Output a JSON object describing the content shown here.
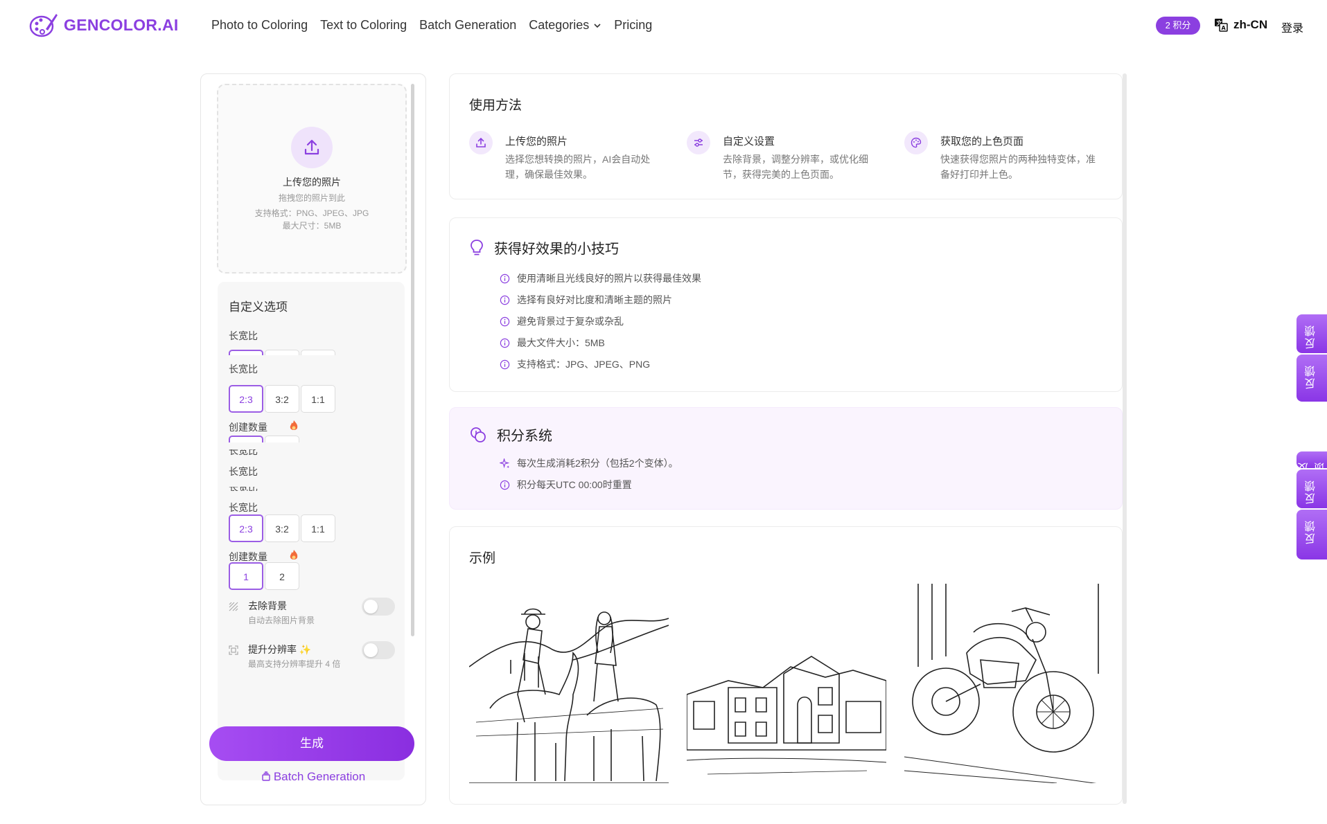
{
  "header": {
    "logo_text": "GENCOLOR.AI",
    "nav": [
      "Photo to Coloring",
      "Text to Coloring",
      "Batch Generation",
      "Categories",
      "Pricing"
    ],
    "credits_badge": "2 积分",
    "language": "zh-CN",
    "login": "登录"
  },
  "upload": {
    "title": "上传您的照片",
    "drag_hint": "拖拽您的照片到此",
    "formats": "支持格式：PNG、JPEG、JPG",
    "max_size": "最大尺寸：5MB"
  },
  "options": {
    "title": "自定义选项",
    "aspect_label": "长宽比",
    "aspect_options": [
      "2:3",
      "3:2",
      "1:1"
    ],
    "aspect_selected": "2:3",
    "count_label": "创建数量",
    "count_options": [
      "1",
      "2"
    ],
    "count_selected": "1",
    "remove_bg_label": "去除背景",
    "remove_bg_sub": "自动去除图片背景",
    "remove_bg_on": false,
    "upscale_label": "提升分辨率 ✨",
    "upscale_sub": "最高支持分辨率提升 4 倍",
    "upscale_on": false
  },
  "actions": {
    "generate": "生成",
    "batch": "Batch Generation"
  },
  "how_to": {
    "title": "使用方法",
    "steps": [
      {
        "icon": "upload-icon",
        "title": "上传您的照片",
        "desc": "选择您想转换的照片，AI会自动处理，确保最佳效果。"
      },
      {
        "icon": "sliders-icon",
        "title": "自定义设置",
        "desc": "去除背景，调整分辨率，或优化细节，获得完美的上色页面。"
      },
      {
        "icon": "palette-icon",
        "title": "获取您的上色页面",
        "desc": "快速获得您照片的两种独特变体，准备好打印并上色。"
      }
    ]
  },
  "tips": {
    "title": "获得好效果的小技巧",
    "items": [
      "使用清晰且光线良好的照片以获得最佳效果",
      "选择有良好对比度和清晰主题的照片",
      "避免背景过于复杂或杂乱",
      "最大文件大小：5MB",
      "支持格式：JPG、JPEG、PNG"
    ]
  },
  "points": {
    "title": "积分系统",
    "items": [
      "每次生成消耗2积分（包括2个变体）。",
      "积分每天UTC 00:00时重置"
    ]
  },
  "examples": {
    "title": "示例",
    "images": [
      "cowboy-riders-coloring-page",
      "house-coloring-page",
      "motorcycle-coloring-page"
    ]
  },
  "side_tabs": [
    "反馈",
    "反馈",
    "反馈",
    "反馈"
  ],
  "colors": {
    "accent": "#8b3fe0",
    "accent_light": "#f2e8fc",
    "points_bg": "#faf4fe"
  }
}
